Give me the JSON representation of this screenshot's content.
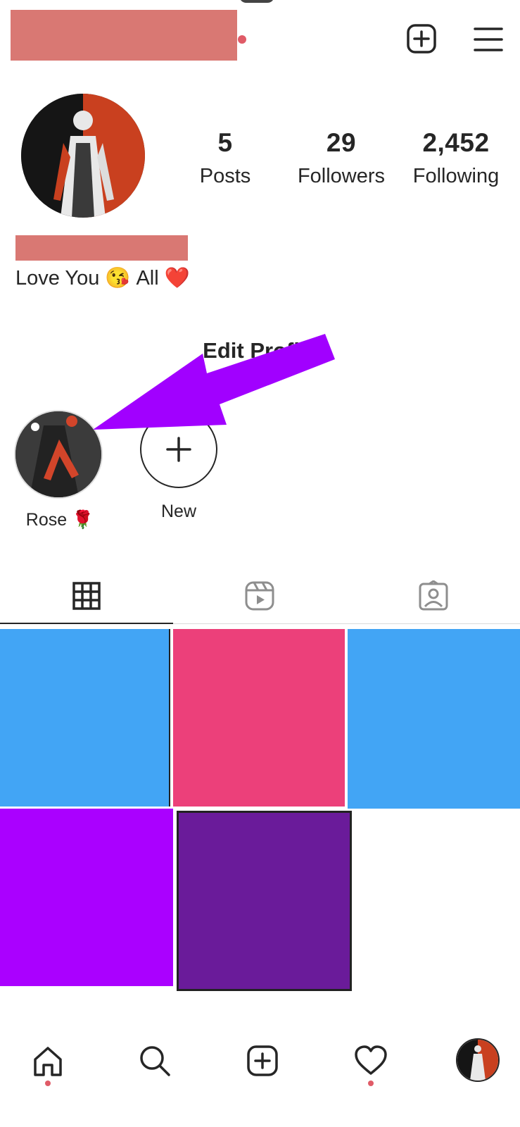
{
  "header": {
    "username_redacted": true,
    "new_post_icon": "plus-square-icon",
    "menu_icon": "hamburger-menu-icon"
  },
  "profile": {
    "stats": [
      {
        "value": "5",
        "label": "Posts"
      },
      {
        "value": "29",
        "label": "Followers"
      },
      {
        "value": "2,452",
        "label": "Following"
      }
    ],
    "name_redacted": true,
    "bio_part1": "Love You",
    "bio_emoji1": "😘",
    "bio_part2": "All",
    "bio_emoji2": "❤️"
  },
  "edit_profile_label": "Edit Profile",
  "highlights": [
    {
      "label": "Rose",
      "emoji": "🌹"
    },
    {
      "label": "New"
    }
  ],
  "tabs": [
    {
      "icon": "grid-icon",
      "active": true
    },
    {
      "icon": "reels-icon",
      "active": false
    },
    {
      "icon": "tagged-icon",
      "active": false
    }
  ],
  "grid_colors": [
    "#42a5f5",
    "#ec407a",
    "#42a5f5",
    "#aa00ff",
    "#6a1b9a"
  ],
  "annotation_color": "#a100ff",
  "bottom_nav": [
    {
      "icon": "home-icon",
      "has_dot": true
    },
    {
      "icon": "search-icon",
      "has_dot": false
    },
    {
      "icon": "plus-square-icon",
      "has_dot": false
    },
    {
      "icon": "heart-icon",
      "has_dot": true
    },
    {
      "icon": "profile-avatar-icon",
      "has_dot": false
    }
  ]
}
